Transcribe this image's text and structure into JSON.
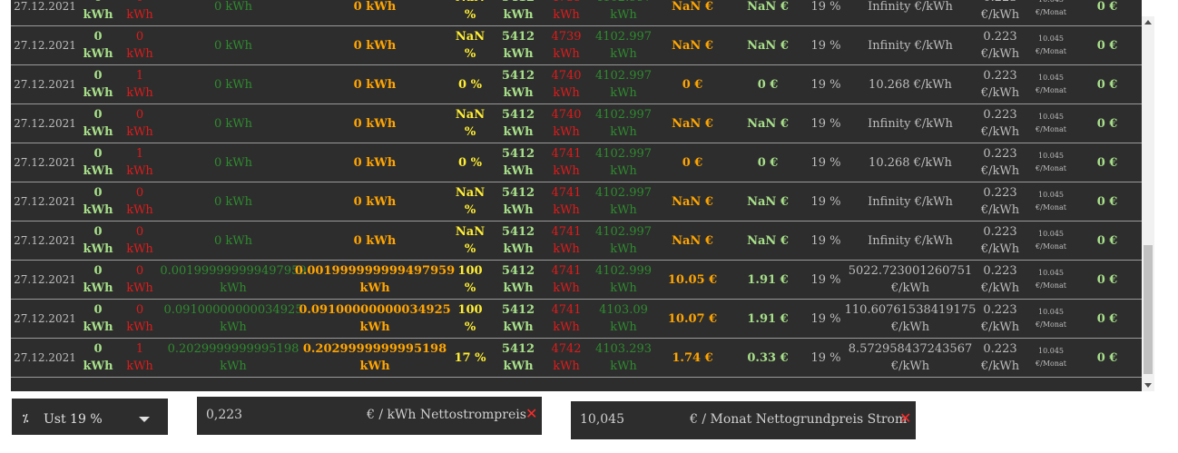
{
  "table": {
    "rows": [
      {
        "date": "27.12.2021",
        "a": "0",
        "a_unit": "kWh",
        "b": "0",
        "b_unit": "kWh",
        "c": "0 kWh",
        "c2": "",
        "d": "0 kWh",
        "d2": "",
        "pct": "NaN",
        "pct_unit": "%",
        "m1": "5412",
        "m1_unit": "kWh",
        "m2": "4739",
        "m2_unit": "kWh",
        "m3": "4102.997",
        "m3_unit": "kWh",
        "cost": "NaN €",
        "net": "NaN €",
        "vat": "19 %",
        "per": "Infinity €/kWh",
        "per2": "",
        "price": "0.223",
        "price_unit": "€/kWh",
        "base": "10.045",
        "base_unit": "€/Monat",
        "total": "0 €"
      },
      {
        "date": "27.12.2021",
        "a": "0",
        "a_unit": "kWh",
        "b": "0",
        "b_unit": "kWh",
        "c": "0 kWh",
        "c2": "",
        "d": "0 kWh",
        "d2": "",
        "pct": "NaN",
        "pct_unit": "%",
        "m1": "5412",
        "m1_unit": "kWh",
        "m2": "4739",
        "m2_unit": "kWh",
        "m3": "4102.997",
        "m3_unit": "kWh",
        "cost": "NaN €",
        "net": "NaN €",
        "vat": "19 %",
        "per": "Infinity €/kWh",
        "per2": "",
        "price": "0.223",
        "price_unit": "€/kWh",
        "base": "10.045",
        "base_unit": "€/Monat",
        "total": "0 €"
      },
      {
        "date": "27.12.2021",
        "a": "0",
        "a_unit": "kWh",
        "b": "1",
        "b_unit": "kWh",
        "c": "0 kWh",
        "c2": "",
        "d": "0 kWh",
        "d2": "",
        "pct": "0 %",
        "pct_unit": "",
        "m1": "5412",
        "m1_unit": "kWh",
        "m2": "4740",
        "m2_unit": "kWh",
        "m3": "4102.997",
        "m3_unit": "kWh",
        "cost": "0 €",
        "net": "0 €",
        "vat": "19 %",
        "per": "10.268 €/kWh",
        "per2": "",
        "price": "0.223",
        "price_unit": "€/kWh",
        "base": "10.045",
        "base_unit": "€/Monat",
        "total": "0 €"
      },
      {
        "date": "27.12.2021",
        "a": "0",
        "a_unit": "kWh",
        "b": "0",
        "b_unit": "kWh",
        "c": "0 kWh",
        "c2": "",
        "d": "0 kWh",
        "d2": "",
        "pct": "NaN",
        "pct_unit": "%",
        "m1": "5412",
        "m1_unit": "kWh",
        "m2": "4740",
        "m2_unit": "kWh",
        "m3": "4102.997",
        "m3_unit": "kWh",
        "cost": "NaN €",
        "net": "NaN €",
        "vat": "19 %",
        "per": "Infinity €/kWh",
        "per2": "",
        "price": "0.223",
        "price_unit": "€/kWh",
        "base": "10.045",
        "base_unit": "€/Monat",
        "total": "0 €"
      },
      {
        "date": "27.12.2021",
        "a": "0",
        "a_unit": "kWh",
        "b": "1",
        "b_unit": "kWh",
        "c": "0 kWh",
        "c2": "",
        "d": "0 kWh",
        "d2": "",
        "pct": "0 %",
        "pct_unit": "",
        "m1": "5412",
        "m1_unit": "kWh",
        "m2": "4741",
        "m2_unit": "kWh",
        "m3": "4102.997",
        "m3_unit": "kWh",
        "cost": "0 €",
        "net": "0 €",
        "vat": "19 %",
        "per": "10.268 €/kWh",
        "per2": "",
        "price": "0.223",
        "price_unit": "€/kWh",
        "base": "10.045",
        "base_unit": "€/Monat",
        "total": "0 €"
      },
      {
        "date": "27.12.2021",
        "a": "0",
        "a_unit": "kWh",
        "b": "0",
        "b_unit": "kWh",
        "c": "0 kWh",
        "c2": "",
        "d": "0 kWh",
        "d2": "",
        "pct": "NaN",
        "pct_unit": "%",
        "m1": "5412",
        "m1_unit": "kWh",
        "m2": "4741",
        "m2_unit": "kWh",
        "m3": "4102.997",
        "m3_unit": "kWh",
        "cost": "NaN €",
        "net": "NaN €",
        "vat": "19 %",
        "per": "Infinity €/kWh",
        "per2": "",
        "price": "0.223",
        "price_unit": "€/kWh",
        "base": "10.045",
        "base_unit": "€/Monat",
        "total": "0 €"
      },
      {
        "date": "27.12.2021",
        "a": "0",
        "a_unit": "kWh",
        "b": "0",
        "b_unit": "kWh",
        "c": "0 kWh",
        "c2": "",
        "d": "0 kWh",
        "d2": "",
        "pct": "NaN",
        "pct_unit": "%",
        "m1": "5412",
        "m1_unit": "kWh",
        "m2": "4741",
        "m2_unit": "kWh",
        "m3": "4102.997",
        "m3_unit": "kWh",
        "cost": "NaN €",
        "net": "NaN €",
        "vat": "19 %",
        "per": "Infinity €/kWh",
        "per2": "",
        "price": "0.223",
        "price_unit": "€/kWh",
        "base": "10.045",
        "base_unit": "€/Monat",
        "total": "0 €"
      },
      {
        "date": "27.12.2021",
        "a": "0",
        "a_unit": "kWh",
        "b": "0",
        "b_unit": "kWh",
        "c": "0.001999999999497959",
        "c2": "kWh",
        "d": "0.001999999999497959",
        "d2": "kWh",
        "pct": "100",
        "pct_unit": "%",
        "m1": "5412",
        "m1_unit": "kWh",
        "m2": "4741",
        "m2_unit": "kWh",
        "m3": "4102.999",
        "m3_unit": "kWh",
        "cost": "10.05 €",
        "net": "1.91 €",
        "vat": "19 %",
        "per": "5022.723001260751",
        "per2": "€/kWh",
        "price": "0.223",
        "price_unit": "€/kWh",
        "base": "10.045",
        "base_unit": "€/Monat",
        "total": "0 €"
      },
      {
        "date": "27.12.2021",
        "a": "0",
        "a_unit": "kWh",
        "b": "0",
        "b_unit": "kWh",
        "c": "0.09100000000034925",
        "c2": "kWh",
        "d": "0.09100000000034925",
        "d2": "kWh",
        "pct": "100",
        "pct_unit": "%",
        "m1": "5412",
        "m1_unit": "kWh",
        "m2": "4741",
        "m2_unit": "kWh",
        "m3": "4103.09",
        "m3_unit": "kWh",
        "cost": "10.07 €",
        "net": "1.91 €",
        "vat": "19 %",
        "per": "110.60761538419175",
        "per2": "€/kWh",
        "price": "0.223",
        "price_unit": "€/kWh",
        "base": "10.045",
        "base_unit": "€/Monat",
        "total": "0 €"
      },
      {
        "date": "27.12.2021",
        "a": "0",
        "a_unit": "kWh",
        "b": "1",
        "b_unit": "kWh",
        "c": "0.2029999999995198",
        "c2": "kWh",
        "d": "0.2029999999995198",
        "d2": "kWh",
        "pct": "17 %",
        "pct_unit": "",
        "m1": "5412",
        "m1_unit": "kWh",
        "m2": "4742",
        "m2_unit": "kWh",
        "m3": "4103.293",
        "m3_unit": "kWh",
        "cost": "1.74 €",
        "net": "0.33 €",
        "vat": "19 %",
        "per": "8.572958437243567",
        "per2": "€/kWh",
        "price": "0.223",
        "price_unit": "€/kWh",
        "base": "10.045",
        "base_unit": "€/Monat",
        "total": "0 €"
      }
    ]
  },
  "controls": {
    "vat_select": {
      "icon": "percent-icon",
      "label": "Ust 19 %"
    },
    "price_field": {
      "value": "0,223",
      "suffix": "€ / kWh Nettostrompreis",
      "clear": "✕"
    },
    "base_field": {
      "value": "10,045",
      "suffix": "€ / Monat Nettogrundpreis Strom",
      "clear": "✕"
    }
  },
  "colors": {
    "panel": "#2d2d2d",
    "green": "#a8e08a",
    "red": "#e01b1b",
    "dark_green": "#2e8b2e",
    "orange": "#ffa500",
    "yellow": "#ffee33"
  }
}
